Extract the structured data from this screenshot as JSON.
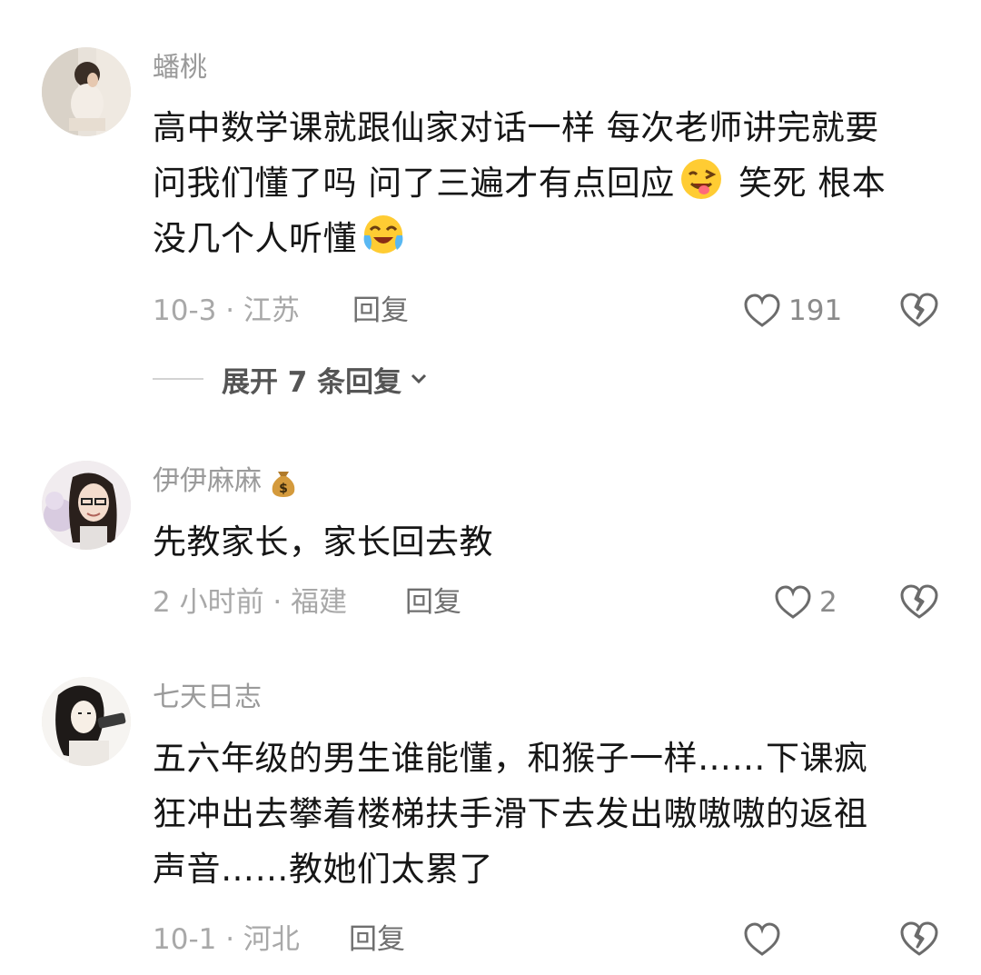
{
  "comments": [
    {
      "username": "蟠桃",
      "lines": [
        "高中数学课就跟仙家对话一样 每次老师讲完就要",
        "问我们懂了吗 问了三遍才有点回应",
        " 笑死 根本",
        "没几个人听懂"
      ],
      "meta": "10-3 · 江苏",
      "reply_label": "回复",
      "likes": "191",
      "emojis": [
        "winking-tongue-face",
        "crying-laughing-face"
      ]
    },
    {
      "username": "伊伊麻麻",
      "badge": "money-bag",
      "lines": [
        "先教家长，家长回去教"
      ],
      "meta": "2 小时前 · 福建",
      "reply_label": "回复",
      "likes": "2"
    },
    {
      "username": "七天日志",
      "lines": [
        "五六年级的男生谁能懂，和猴子一样……下课疯",
        "狂冲出去攀着楼梯扶手滑下去发出嗷嗷嗷的返祖",
        "声音……教她们太累了"
      ],
      "meta": "10-1 · 河北",
      "reply_label": "回复"
    }
  ],
  "expand_replies": "展开 7 条回复",
  "colors": {
    "text": "#161616",
    "username": "#9a9a9a",
    "meta": "#a8a8a8",
    "icon": "#6b6b6b"
  }
}
